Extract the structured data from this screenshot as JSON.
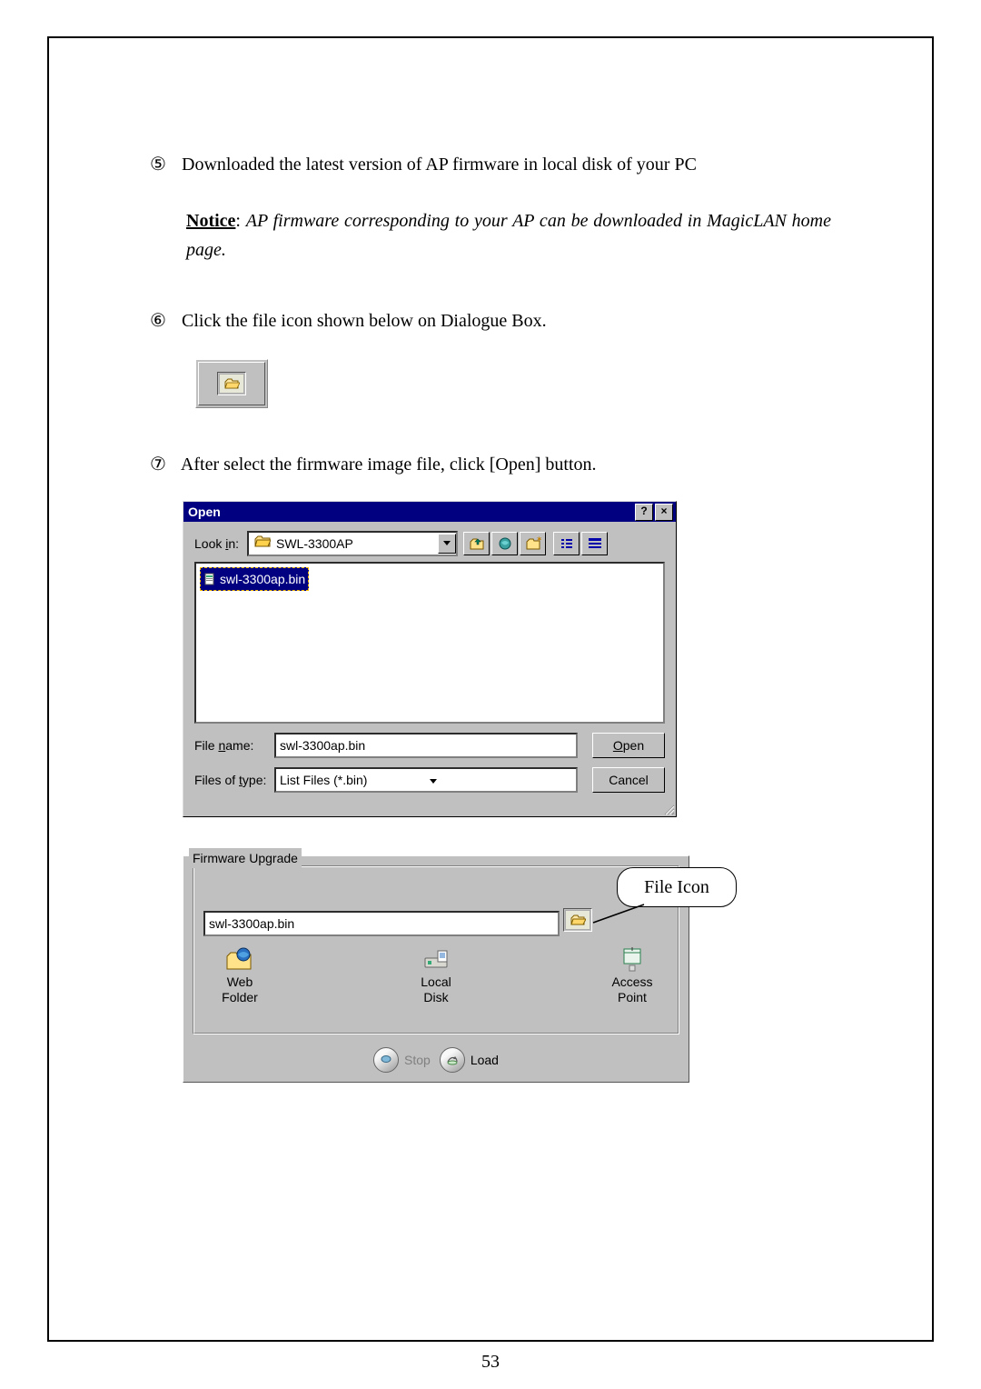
{
  "steps": {
    "s5_num": "⑤",
    "s5_text": "Downloaded the latest version of AP firmware in local disk of your PC",
    "notice_label": "Notice",
    "notice_colon": ": ",
    "notice_italic": "AP firmware corresponding to your AP can be downloaded in MagicLAN home page.",
    "s6_num": "⑥",
    "s6_text": "Click the file icon shown below on Dialogue Box.",
    "s7_num": "⑦",
    "s7_text": "After select the firmware image file, click [Open] button."
  },
  "open_dialog": {
    "title": "Open",
    "help_btn": "?",
    "close_btn": "×",
    "look_in_label_pre": "Look ",
    "look_in_label_u": "i",
    "look_in_label_post": "n:",
    "folder_name": "SWL-3300AP",
    "file_selected": "swl-3300ap.bin",
    "file_name_label_pre": "File ",
    "file_name_label_u": "n",
    "file_name_label_post": "ame:",
    "file_name_value": "swl-3300ap.bin",
    "files_type_label_pre": "Files of ",
    "files_type_label_u": "t",
    "files_type_label_post": "ype:",
    "files_type_value": "List Files (*.bin)",
    "open_btn_u": "O",
    "open_btn_rest": "pen",
    "cancel_btn": "Cancel"
  },
  "firmware": {
    "group_title": "Firmware Upgrade",
    "path_value": "swl-3300ap.bin",
    "col1a": "Web",
    "col1b": "Folder",
    "col2a": "Local",
    "col2b": "Disk",
    "col3a": "Access",
    "col3b": "Point",
    "stop": "Stop",
    "load": "Load"
  },
  "callout": "File Icon",
  "page_number": "53"
}
